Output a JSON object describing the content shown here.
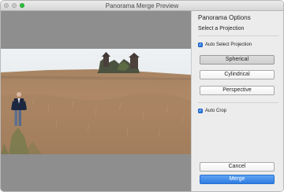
{
  "window": {
    "title": "Panorama Merge Preview"
  },
  "sidebar": {
    "heading": "Panorama Options",
    "subheading": "Select a Projection",
    "auto_select_label": "Auto Select Projection",
    "auto_select_checked": true,
    "projections": [
      {
        "label": "Spherical",
        "selected": true
      },
      {
        "label": "Cylindrical",
        "selected": false
      },
      {
        "label": "Perspective",
        "selected": false
      }
    ],
    "auto_crop_label": "Auto Crop",
    "auto_crop_checked": true,
    "cancel_label": "Cancel",
    "merge_label": "Merge"
  },
  "colors": {
    "accent": "#2f7de1",
    "preview_bg": "#8e8e8e",
    "sidebar_bg": "#ececec"
  },
  "icons": {
    "close": "traffic-light-close",
    "minimize": "traffic-light-minimize",
    "zoom": "traffic-light-zoom",
    "check": "checkmark"
  }
}
